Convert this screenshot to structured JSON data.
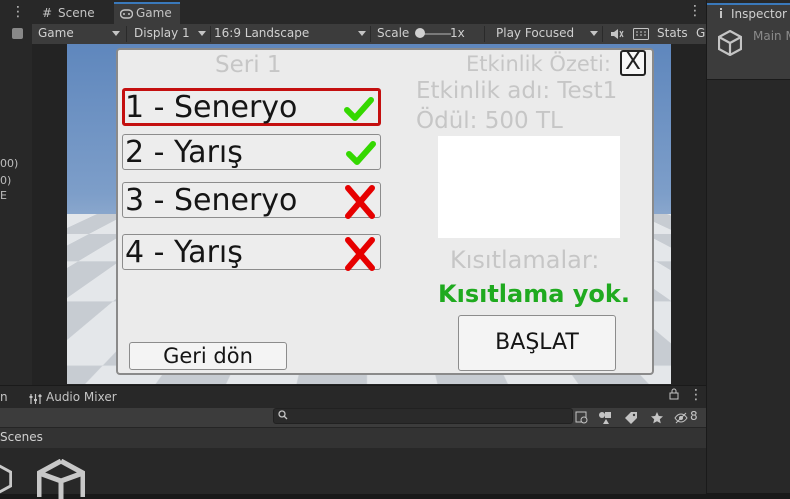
{
  "editor": {
    "tabs": [
      {
        "label": "Scene",
        "icon": "grid-icon"
      },
      {
        "label": "Game",
        "icon": "gamepad-icon"
      }
    ],
    "toolbar": {
      "view": "Game",
      "display": "Display 1",
      "aspect": "16:9 Landscape",
      "scale_label": "Scale",
      "scale_value": "1x",
      "play_mode": "Play Focused",
      "stats": "Stats",
      "cut_off_label": "G"
    },
    "hierarchy_fragments": [
      "00)",
      "0)",
      "E"
    ],
    "inspector": {
      "tab": "Inspector",
      "object_name": "Main M"
    },
    "bottom": {
      "tabs": [
        {
          "label": "n",
          "icon": "none"
        },
        {
          "label": "Audio Mixer",
          "icon": "mixer-icon"
        }
      ],
      "section": "Scenes",
      "visibility_count": "8"
    }
  },
  "game_ui": {
    "series_title": "Seri 1",
    "races": [
      {
        "label": "1 - Seneryo",
        "completed": true,
        "selected": true
      },
      {
        "label": "2 - Yarış",
        "completed": true,
        "selected": false
      },
      {
        "label": "3 - Seneryo",
        "completed": false,
        "selected": false
      },
      {
        "label": "4 - Yarış",
        "completed": false,
        "selected": false
      }
    ],
    "summary_title": "Etkinlik Özeti:",
    "event_name": "Etkinlik adı: Test1",
    "reward": "Ödül: 500 TL",
    "restrictions_title": "Kısıtlamalar:",
    "restrictions_value": "Kısıtlama yok.",
    "start_button": "BAŞLAT",
    "back_button": "Geri dön",
    "close_button": "X"
  },
  "colors": {
    "check": "#34d800",
    "cross": "#e60000",
    "selected_border": "#c40f0f",
    "restriction_ok": "#1faa1f",
    "editor_accent": "#3a79bb"
  }
}
